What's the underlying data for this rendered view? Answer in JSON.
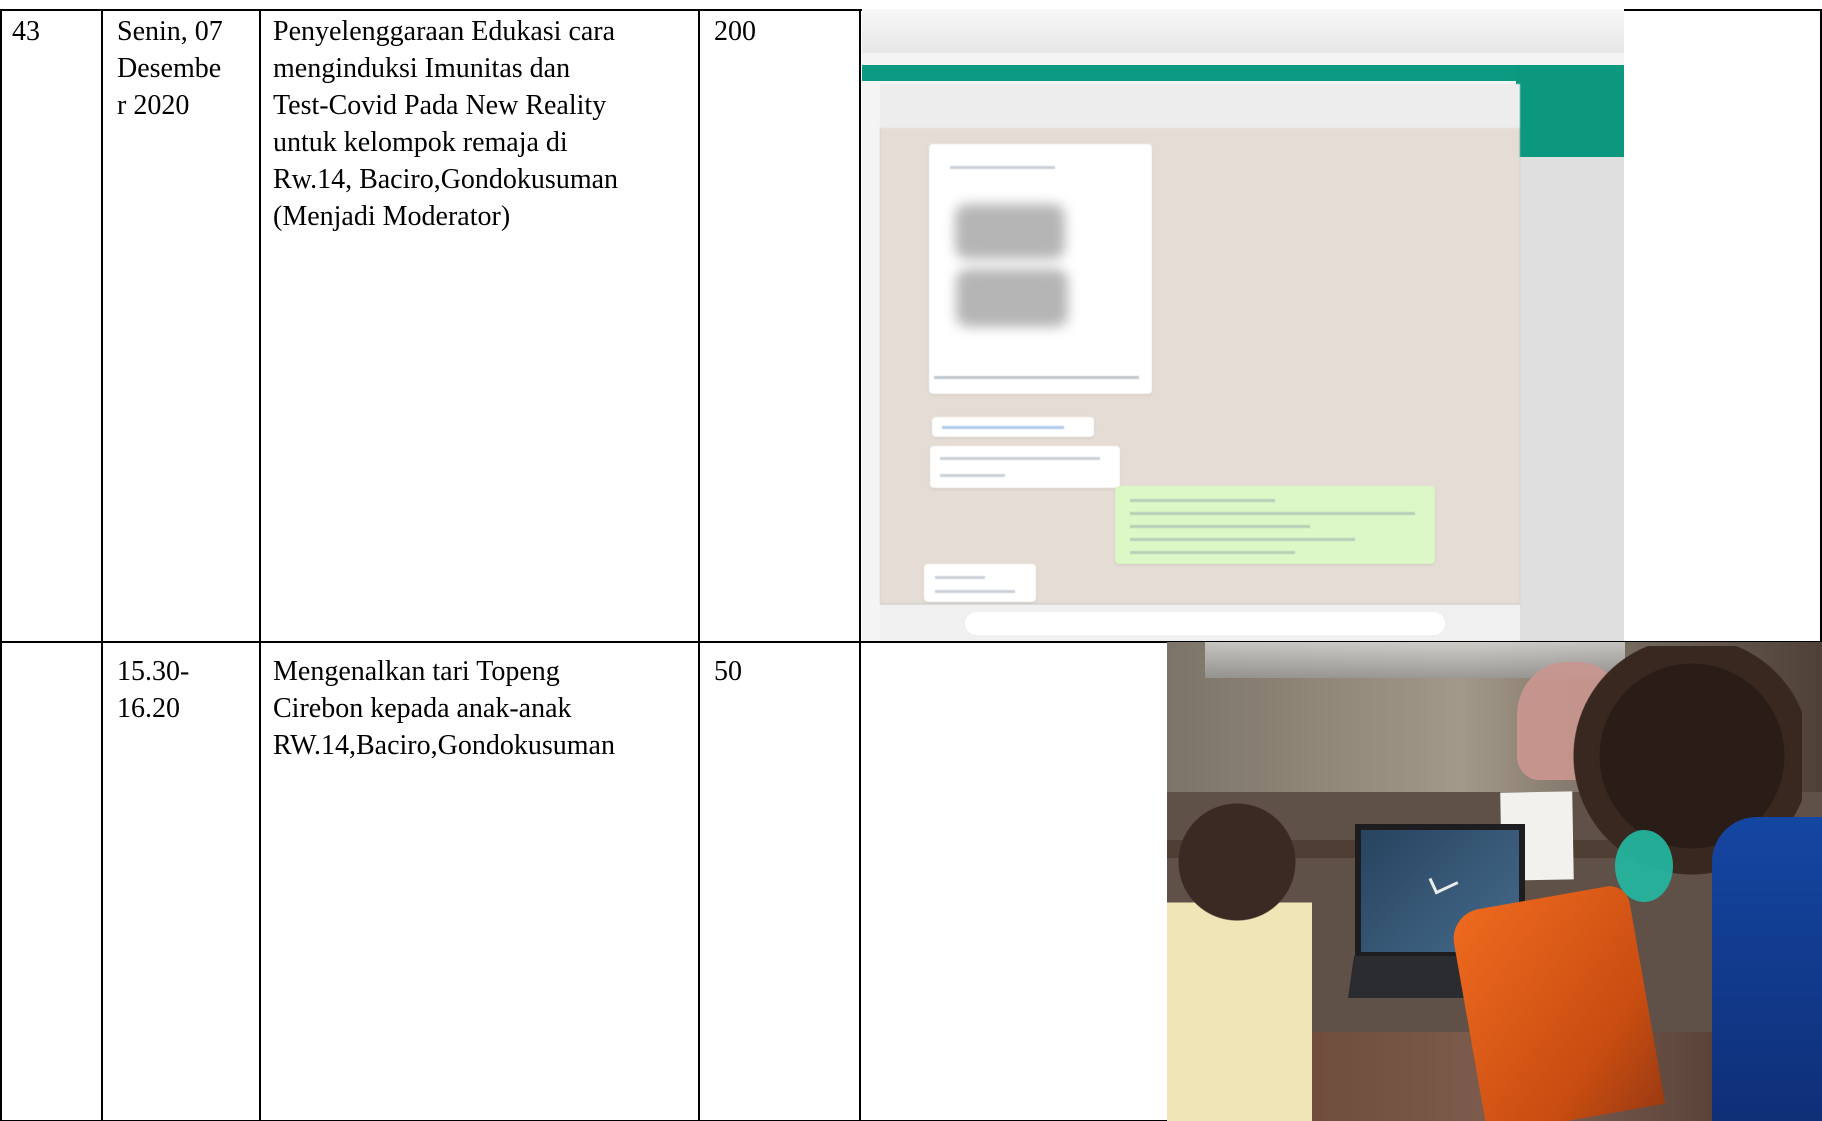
{
  "table": {
    "rows": [
      {
        "number": "43",
        "day_date": "Senin, 07\nDesembe\nr 2020",
        "activity": "Penyelenggaraan Edukasi cara\nmenginduksi Imunitas dan\nTest-Covid  Pada New Reality\nuntuk kelompok remaja di\nRw.14, Baciro,Gondokusuman\n(Menjadi Moderator)",
        "value": "200"
      },
      {
        "number": "",
        "day_date": "15.30-\n16.20",
        "activity": "Mengenalkan tari Topeng\nCirebon kepada anak-anak\nRW.14,Baciro,Gondokusuman",
        "value": "50"
      }
    ]
  },
  "images": {
    "chat_screenshot": "chat-screenshot-image",
    "children_photo": "children-laptop-photo"
  },
  "colors": {
    "table_border": "#000000",
    "chat_teal": "#0d9a82",
    "chat_background": "#e5ddd5",
    "message_green": "#dcf8c6"
  }
}
